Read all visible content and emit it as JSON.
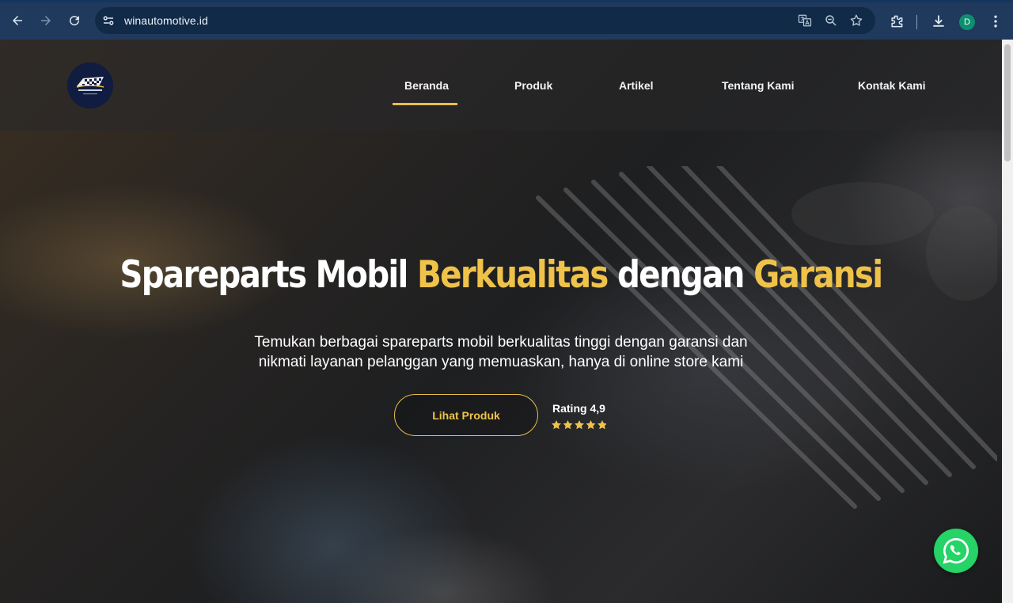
{
  "browser": {
    "url": "winautomotive.id",
    "avatar_letter": "D",
    "icons": [
      "back-icon",
      "forward-icon",
      "reload-icon",
      "site-settings-icon",
      "translate-icon",
      "zoom-icon",
      "bookmark-star-icon",
      "extensions-icon",
      "download-icon",
      "more-menu-icon"
    ]
  },
  "header": {
    "logo_alt": "Win Automotive logo",
    "nav": [
      {
        "label": "Beranda",
        "active": true
      },
      {
        "label": "Produk",
        "active": false
      },
      {
        "label": "Artikel",
        "active": false
      },
      {
        "label": "Tentang Kami",
        "active": false
      },
      {
        "label": "Kontak Kami",
        "active": false
      }
    ]
  },
  "hero": {
    "title_part1": "Spareparts Mobil ",
    "title_highlight1": "Berkualitas",
    "title_part2": " dengan ",
    "title_highlight2": "Garansi",
    "subtitle_line1": "Temukan berbagai spareparts mobil berkualitas tinggi dengan garansi dan",
    "subtitle_line2": "nikmati layanan pelanggan yang memuaskan, hanya di online store kami",
    "cta_label": "Lihat Produk",
    "rating_label": "Rating 4,9",
    "rating_value": 4.9,
    "rating_max": 5
  },
  "colors": {
    "accent": "#efc24a",
    "whatsapp": "#25d366",
    "chrome": "#1f3a5c"
  },
  "floating": {
    "whatsapp_icon": "whatsapp-icon"
  }
}
